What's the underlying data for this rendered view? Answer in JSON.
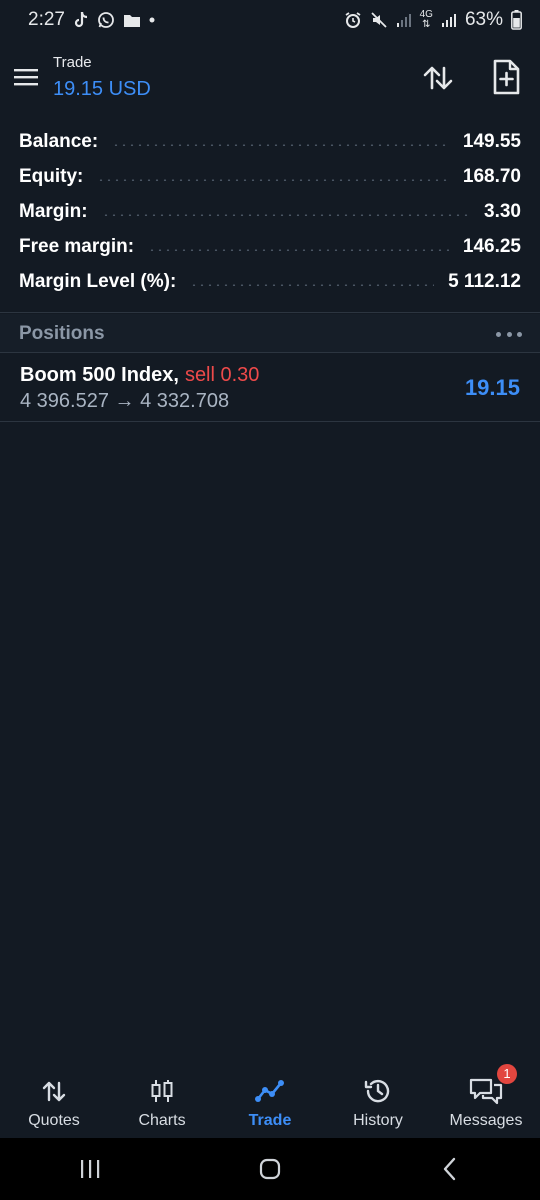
{
  "status_bar": {
    "time": "2:27",
    "battery": "63%",
    "network": "4G"
  },
  "header": {
    "title": "Trade",
    "subtitle": "19.15 USD"
  },
  "summary": [
    {
      "label": "Balance:",
      "value": "149.55"
    },
    {
      "label": "Equity:",
      "value": "168.70"
    },
    {
      "label": "Margin:",
      "value": "3.30"
    },
    {
      "label": "Free margin:",
      "value": "146.25"
    },
    {
      "label": "Margin Level (%):",
      "value": "5 112.12"
    }
  ],
  "positions": {
    "title": "Positions",
    "items": [
      {
        "symbol": "Boom 500 Index,",
        "side": "sell 0.30",
        "open_price": "4 396.527",
        "arrow": "→",
        "current_price": "4 332.708",
        "profit": "19.15"
      }
    ]
  },
  "bottom_nav": [
    {
      "label": "Quotes",
      "icon": "quotes-icon"
    },
    {
      "label": "Charts",
      "icon": "charts-icon"
    },
    {
      "label": "Trade",
      "icon": "trade-icon",
      "active": true
    },
    {
      "label": "History",
      "icon": "history-icon"
    },
    {
      "label": "Messages",
      "icon": "messages-icon",
      "badge": "1"
    }
  ],
  "colors": {
    "background": "#131a23",
    "accent": "#3d8ef7",
    "sell": "#ee4a4a",
    "badge": "#e2463f"
  }
}
